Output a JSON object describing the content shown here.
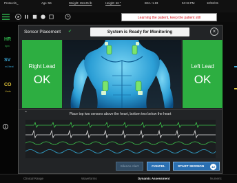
{
  "header": {
    "patient_id": "Protocol1_",
    "age": "Age: 56",
    "weight": "Weight: 154.25 lb",
    "height": "Height: 66 \"",
    "bsa": "BSA: 1.83",
    "time": "04:19 PM",
    "date": "10/26/15"
  },
  "controls": {
    "last_assessed": "last assessed",
    "alert_message": "Learning the patient, keep the patient still",
    "icons": [
      "play-icon",
      "pause-icon",
      "stop-icon",
      "record-icon",
      "clock-icon"
    ]
  },
  "left_params": {
    "hr": {
      "label": "HR",
      "unit": "bpm"
    },
    "sv": {
      "label": "SV",
      "unit": "mL/beat"
    },
    "co": {
      "label": "CO",
      "unit": "L/min"
    }
  },
  "modal": {
    "title": "Sensor Placement",
    "status": "System is Ready for Monitoring",
    "left_lead": {
      "label": "Right Lead",
      "status": "OK"
    },
    "right_lead": {
      "label": "Left Lead",
      "status": "OK"
    },
    "instruction": "Place top two sensors above the heart, bottom two below the heart",
    "buttons": {
      "silence": "Silence Alert",
      "cancel": "CANCEL",
      "start": "START SESSION",
      "countdown": "12"
    }
  },
  "bottom_tabs": [
    {
      "label": "Clinical Range"
    },
    {
      "label": "Waveforms"
    },
    {
      "label": "Dynamic Assessment"
    },
    {
      "label": "Numeric"
    }
  ],
  "colors": {
    "ok_green": "#2dae41",
    "alert_red": "#d8121b",
    "accent_blue": "#2a6fb1",
    "hr_green": "#2fb24c",
    "sv_blue": "#3aa8d8",
    "co_yellow": "#e0c43a"
  }
}
